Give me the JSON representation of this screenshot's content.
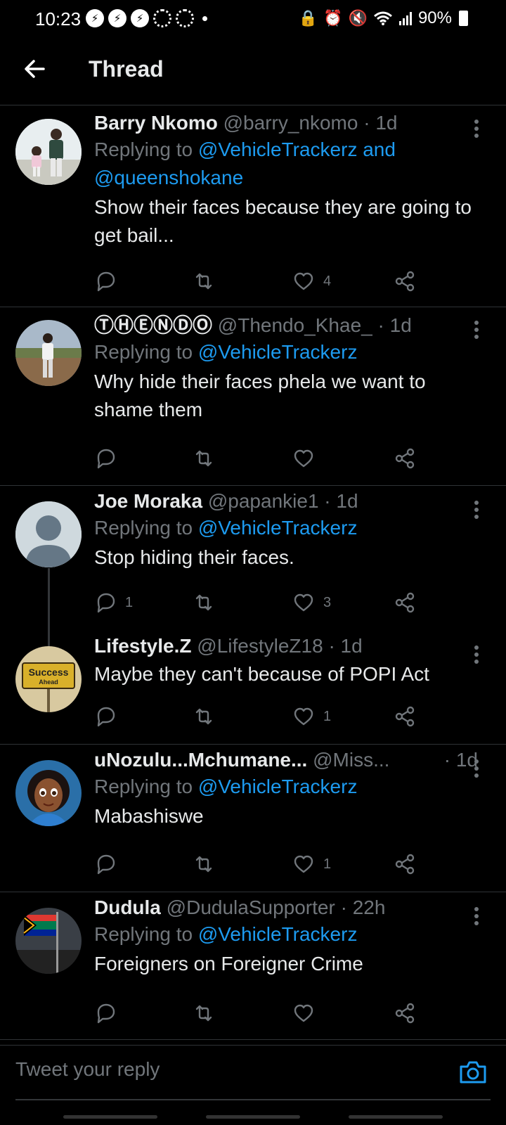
{
  "status_bar": {
    "time": "10:23",
    "battery": "90%",
    "left_icons": [
      "notification-icon",
      "notification-icon",
      "notification-icon",
      "sync-icon",
      "sync-icon"
    ],
    "right_icons": [
      "vpn-icon",
      "alarm-icon",
      "mute-icon",
      "wifi-icon",
      "signal-icon",
      "battery-icon"
    ]
  },
  "header": {
    "title": "Thread"
  },
  "tweets": [
    {
      "name": "Barry Nkomo",
      "handle": "@barry_nkomo",
      "time": "1d",
      "replying_prefix": "Replying to ",
      "replying_to": "@VehicleTrackerz and @queenshokane",
      "text": "Show their faces because they are going to get bail...",
      "replies": "",
      "retweets": "",
      "likes": "4"
    },
    {
      "name": "ⓉⒽⒺⓃⒹⓄ",
      "handle": "@Thendo_Khae_",
      "time": "1d",
      "replying_prefix": "Replying to ",
      "replying_to": "@VehicleTrackerz",
      "text": "Why hide their faces phela we want to shame them",
      "replies": "",
      "retweets": "",
      "likes": ""
    },
    {
      "name": "Joe Moraka",
      "handle": "@papankie1",
      "time": "1d",
      "replying_prefix": "Replying to ",
      "replying_to": "@VehicleTrackerz",
      "text": "Stop hiding their faces.",
      "replies": "1",
      "retweets": "",
      "likes": "3"
    },
    {
      "name": "Lifestyle.Z",
      "handle": "@LifestyleZ18",
      "time": "1d",
      "text": "Maybe they can't because of POPI Act",
      "avatar_sign_top": "Success",
      "avatar_sign_bottom": "Ahead",
      "replies": "",
      "retweets": "",
      "likes": "1"
    },
    {
      "name": "uNozulu...Mchumane...",
      "handle": "@Miss...",
      "time": "1d",
      "replying_prefix": "Replying to ",
      "replying_to": "@VehicleTrackerz",
      "text": "Mabashiswe",
      "replies": "",
      "retweets": "",
      "likes": "1"
    },
    {
      "name": "Dudula",
      "handle": "@DudulaSupporter",
      "time": "22h",
      "replying_prefix": "Replying to ",
      "replying_to": "@VehicleTrackerz",
      "text": "Foreigners on Foreigner Crime",
      "replies": "",
      "retweets": "",
      "likes": ""
    }
  ],
  "reply_bar": {
    "placeholder": "Tweet your reply"
  },
  "colors": {
    "link": "#1d9bf0",
    "muted": "#71767b",
    "text": "#e7e9ea",
    "divider": "#2f3336"
  }
}
